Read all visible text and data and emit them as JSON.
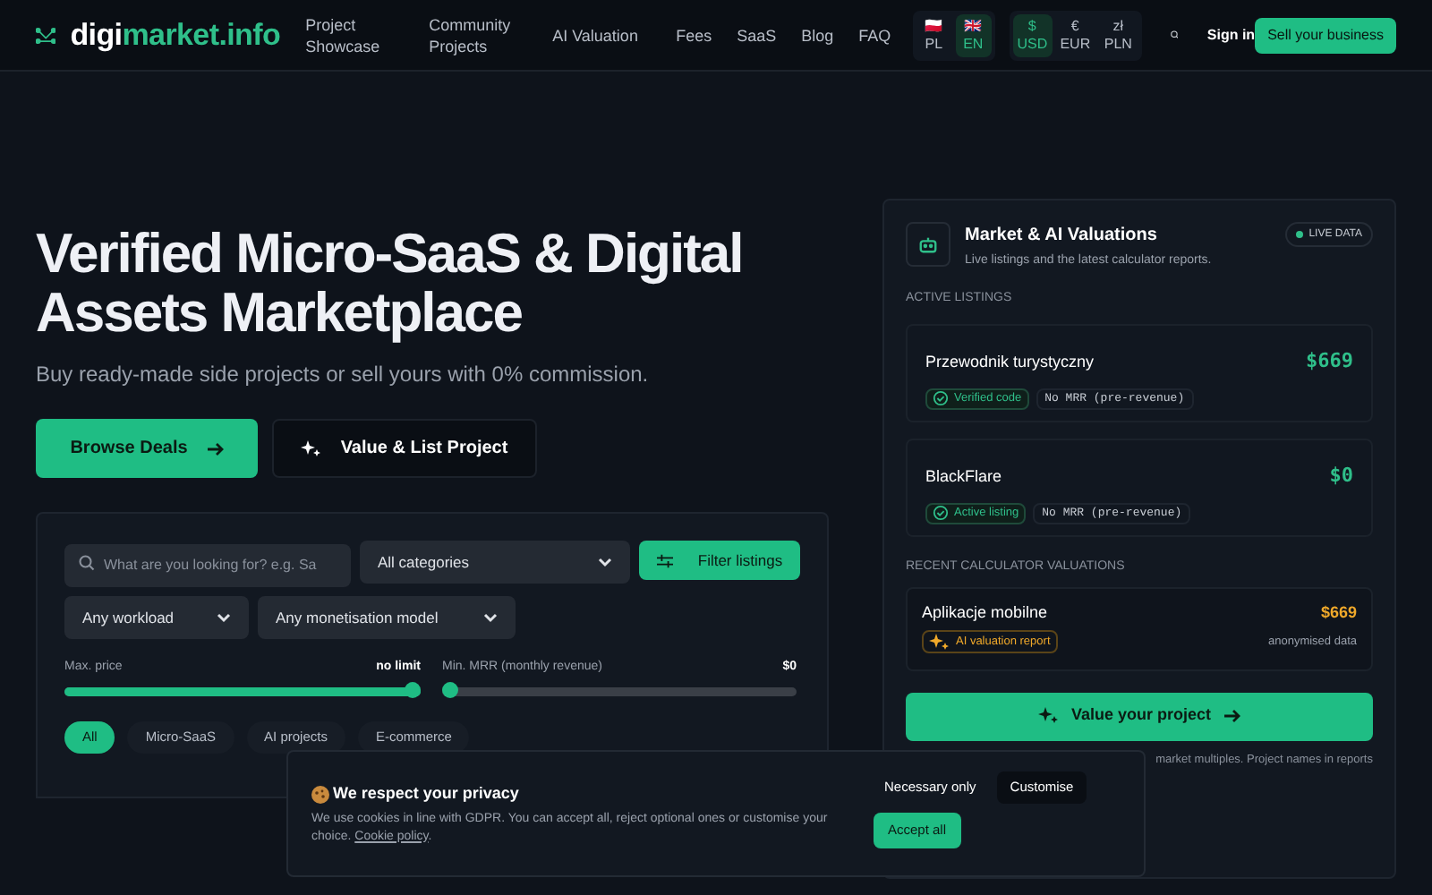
{
  "brand": {
    "part1": "digi",
    "part2": "market.info"
  },
  "nav": [
    "Project Showcase",
    "Community Projects",
    "AI Valuation",
    "Fees",
    "SaaS",
    "Blog",
    "FAQ"
  ],
  "languages": [
    {
      "flag": "🇵🇱",
      "label": "PL",
      "selected": false
    },
    {
      "flag": "🇬🇧",
      "label": "EN",
      "selected": true
    }
  ],
  "currencies": [
    {
      "symbol": "$",
      "label": "USD",
      "selected": true
    },
    {
      "symbol": "€",
      "label": "EUR",
      "selected": false
    },
    {
      "symbol": "zł",
      "label": "PLN",
      "selected": false
    }
  ],
  "sign_in": "Sign in",
  "sell_button": "Sell your business",
  "hero": {
    "title": "Verified Micro-SaaS & Digital Assets Marketplace",
    "subtitle": "Buy ready-made side projects or sell yours with 0% commission.",
    "primary": "Browse Deals",
    "secondary": "Value & List Project"
  },
  "filters": {
    "search_placeholder": "What are you looking for? e.g. Sa",
    "category": "All categories",
    "filter_button": "Filter listings",
    "workload": "Any workload",
    "monetisation": "Any monetisation model",
    "sliders": [
      {
        "label": "Max. price",
        "reading": "no limit",
        "level": 1
      },
      {
        "label": "Min. MRR (monthly revenue)",
        "reading": "$0",
        "level": 0
      }
    ],
    "chips": [
      {
        "label": "All",
        "selected": true
      },
      {
        "label": "Micro-SaaS",
        "selected": false
      },
      {
        "label": "AI projects",
        "selected": false
      },
      {
        "label": "E-commerce",
        "selected": false
      }
    ]
  },
  "panel": {
    "title": "Market & AI Valuations",
    "subtitle": "Live listings and the latest calculator reports.",
    "badge": "LIVE DATA",
    "active_heading": "ACTIVE LISTINGS",
    "listings": [
      {
        "name": "Przewodnik turystyczny",
        "price": "$669",
        "tag": "Verified code",
        "mrr": "No MRR (pre-revenue)"
      },
      {
        "name": "BlackFlare",
        "price": "$0",
        "tag": "Active listing",
        "mrr": "No MRR (pre-revenue)"
      }
    ],
    "recent_heading": "RECENT CALCULATOR VALUATIONS",
    "valuation": {
      "name": "Aplikacje mobilne",
      "price": "$669",
      "tag": "AI valuation report",
      "note": "anonymised data"
    },
    "cta": "Value your project",
    "footnote": "market multiples. Project names in reports"
  },
  "cookie": {
    "title": "We respect your privacy",
    "text": "We use cookies in line with GDPR. You can accept all, reject optional ones or customise your choice.",
    "link": "Cookie policy",
    "text_end": ".",
    "necessary": "Necessary only",
    "customise": "Customise",
    "accept": "Accept all"
  }
}
